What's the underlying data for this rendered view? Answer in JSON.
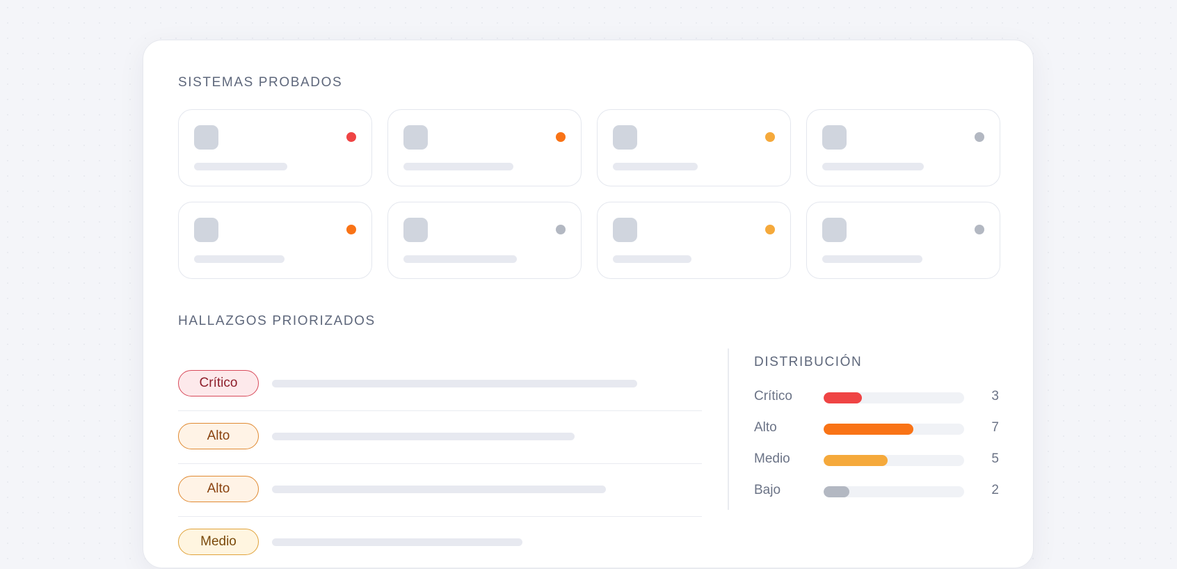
{
  "sections": {
    "systems_title": "SISTEMAS PROBADOS",
    "findings_title": "HALLAZGOS PRIORIZADOS",
    "distribution_title": "DISTRIBUCIÓN"
  },
  "colors": {
    "critical": "#ef4444",
    "high": "#f97316",
    "medium": "#f5a93b",
    "low": "#b3b8c2"
  },
  "systems": [
    {
      "status_color": "#ef4444",
      "placeholder_fill": 0.56
    },
    {
      "status_color": "#f97316",
      "placeholder_fill": 0.66
    },
    {
      "status_color": "#f5a93b",
      "placeholder_fill": 0.51
    },
    {
      "status_color": "#b3b8c2",
      "placeholder_fill": 0.61
    },
    {
      "status_color": "#f97316",
      "placeholder_fill": 0.54
    },
    {
      "status_color": "#b3b8c2",
      "placeholder_fill": 0.68
    },
    {
      "status_color": "#f5a93b",
      "placeholder_fill": 0.47
    },
    {
      "status_color": "#b3b8c2",
      "placeholder_fill": 0.6
    }
  ],
  "findings": [
    {
      "label": "Crítico",
      "bg": "#fde9eb",
      "border": "#d84a5a",
      "text": "#8e1f2b",
      "placeholder_fill": 0.7
    },
    {
      "label": "Alto",
      "bg": "#fff3e6",
      "border": "#e08a32",
      "text": "#8a4310",
      "placeholder_fill": 0.58
    },
    {
      "label": "Alto",
      "bg": "#fff3e6",
      "border": "#e08a32",
      "text": "#8a4310",
      "placeholder_fill": 0.64
    },
    {
      "label": "Medio",
      "bg": "#fff5e0",
      "border": "#e0a23a",
      "text": "#7a4a0c",
      "placeholder_fill": 0.48
    }
  ],
  "distribution": [
    {
      "label": "Crítico",
      "count": "3",
      "value": 3,
      "color": "#ef4444"
    },
    {
      "label": "Alto",
      "count": "7",
      "value": 7,
      "color": "#f97316"
    },
    {
      "label": "Medio",
      "count": "5",
      "value": 5,
      "color": "#f5a93b"
    },
    {
      "label": "Bajo",
      "count": "2",
      "value": 2,
      "color": "#b3b8c2"
    }
  ],
  "distribution_max": 11
}
